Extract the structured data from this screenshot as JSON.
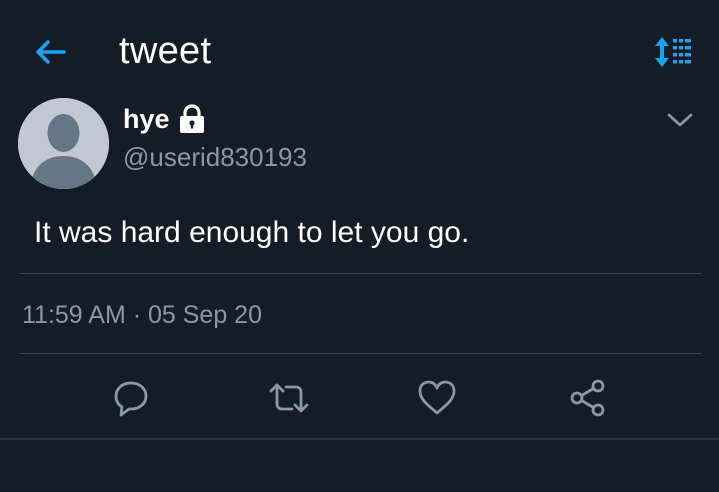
{
  "header": {
    "title": "tweet",
    "back_icon": "arrow-left-icon",
    "sort_icon": "sort-icon"
  },
  "tweet": {
    "author_name": "hye",
    "handle": "@userid830193",
    "protected_icon": "lock-icon",
    "text": "It was hard enough to let you go.",
    "timestamp": "11:59 AM · 05 Sep 20"
  },
  "actions": [
    {
      "icon": "reply-icon"
    },
    {
      "icon": "retweet-icon"
    },
    {
      "icon": "like-icon"
    },
    {
      "icon": "share-icon"
    }
  ],
  "colors": {
    "background": "#141d26",
    "accent": "#1da1f2",
    "secondary_text": "#8899a6",
    "divider": "#38444d"
  }
}
